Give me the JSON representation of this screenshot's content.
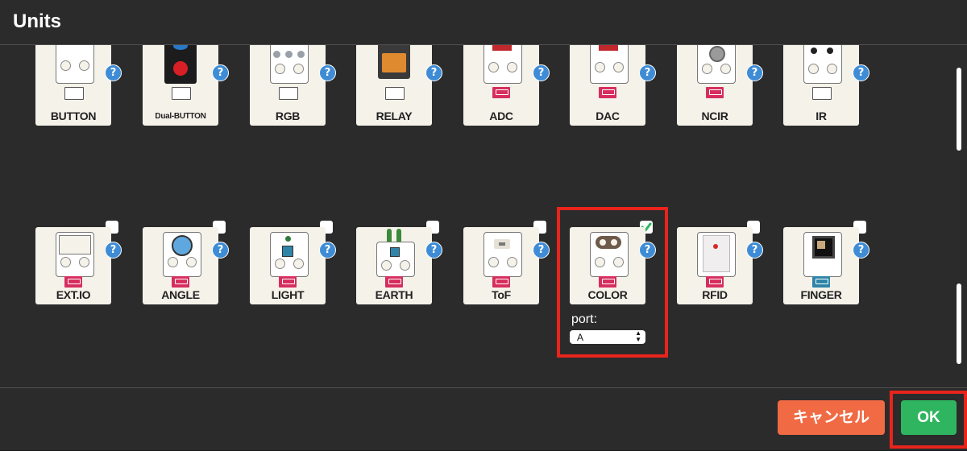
{
  "dialog": {
    "title": "Units"
  },
  "units_row1": [
    {
      "name": "BUTTON",
      "help": "?"
    },
    {
      "name": "Dual-BUTTON",
      "help": "?"
    },
    {
      "name": "RGB",
      "help": "?"
    },
    {
      "name": "RELAY",
      "help": "?"
    },
    {
      "name": "ADC",
      "help": "?"
    },
    {
      "name": "DAC",
      "help": "?"
    },
    {
      "name": "NCIR",
      "help": "?"
    },
    {
      "name": "IR",
      "help": "?"
    }
  ],
  "units_row2": [
    {
      "name": "EXT.IO",
      "help": "?",
      "checked": false
    },
    {
      "name": "ANGLE",
      "help": "?",
      "checked": false
    },
    {
      "name": "LIGHT",
      "help": "?",
      "checked": false
    },
    {
      "name": "EARTH",
      "help": "?",
      "checked": false
    },
    {
      "name": "ToF",
      "help": "?",
      "checked": false
    },
    {
      "name": "COLOR",
      "help": "?",
      "checked": true
    },
    {
      "name": "RFID",
      "help": "?",
      "checked": false
    },
    {
      "name": "FINGER",
      "help": "?",
      "checked": false
    }
  ],
  "color_port": {
    "label": "port:",
    "value": "A"
  },
  "footer": {
    "cancel_label": "キャンセル",
    "ok_label": "OK"
  },
  "colors": {
    "background": "#2b2b2b",
    "card": "#f5f2ea",
    "help_icon": "#3f8cd6",
    "highlight": "#e8241c",
    "cancel": "#f06a44",
    "ok": "#2fb55f",
    "check": "#2fb55f"
  },
  "icons": {
    "help": "question-circle-icon",
    "check": "check-icon",
    "select_arrows": "up-down-arrows-icon"
  }
}
